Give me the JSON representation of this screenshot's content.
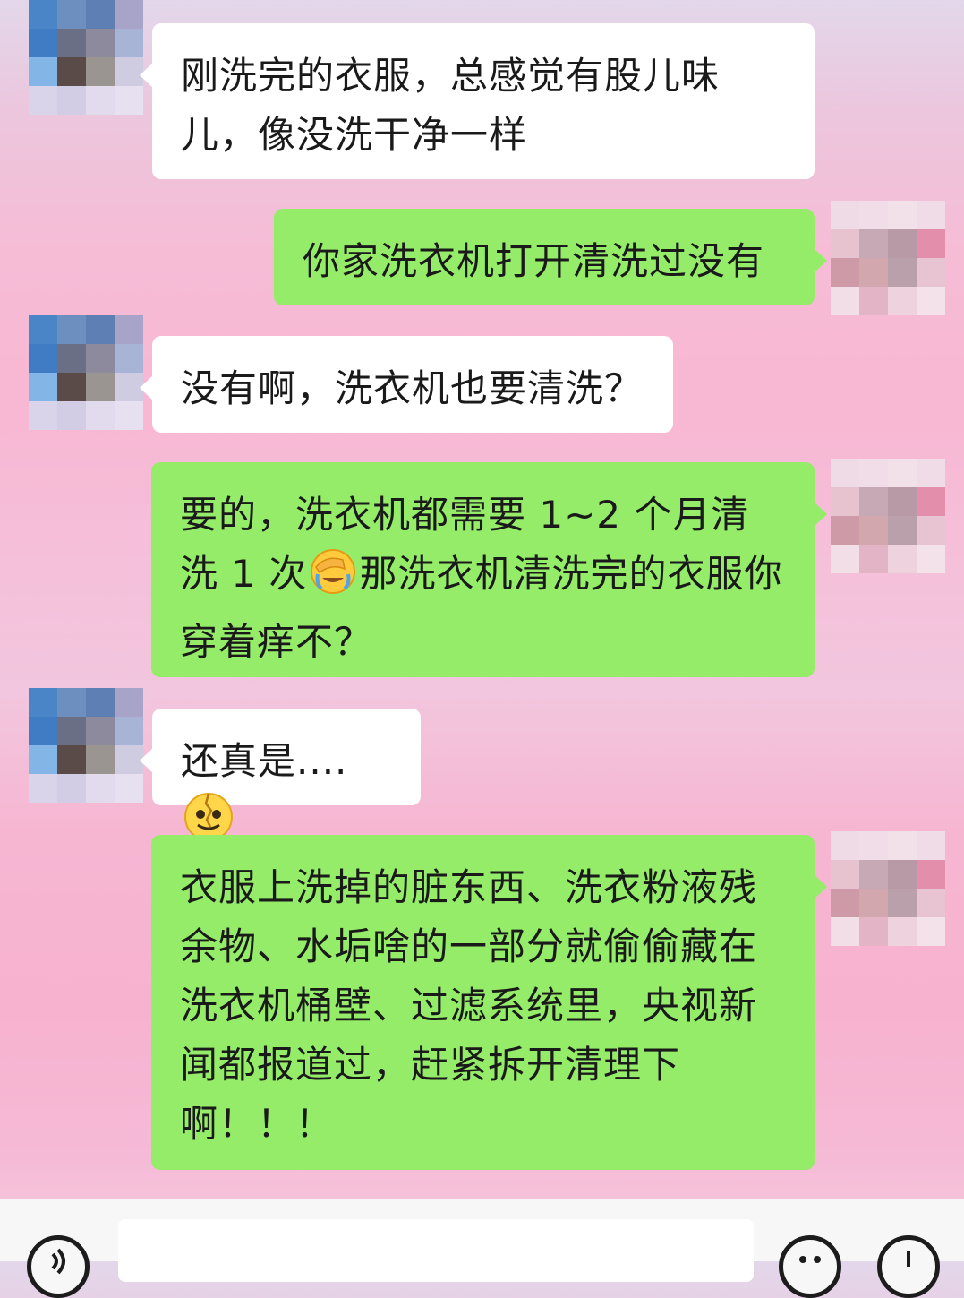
{
  "messages": [
    {
      "id": "m1",
      "side": "left",
      "text": "刚洗完的衣服，总感觉有股儿味儿，像没洗干净一样"
    },
    {
      "id": "m2",
      "side": "right",
      "text": "你家洗衣机打开清洗过没有"
    },
    {
      "id": "m3",
      "side": "left",
      "text": "没有啊，洗衣机也要清洗？"
    },
    {
      "id": "m4",
      "side": "right",
      "text_before_emoji": "要的，洗衣机都需要 1~2 个月清洗 1 次",
      "emoji": "facepalm-crying",
      "text_after_emoji": "那洗衣机清洗完的衣服你穿着痒不？"
    },
    {
      "id": "m5",
      "side": "left",
      "text_before_emoji": "还真是....",
      "emoji": "cracked-smile"
    },
    {
      "id": "m6",
      "side": "right",
      "text": "衣服上洗掉的脏东西、洗衣粉液残余物、水垢啥的一部分就偷偷藏在洗衣机桶壁、过滤系统里，央视新闻都报道过，赶紧拆开清理下啊！！！"
    }
  ],
  "avatars": {
    "left": {
      "description": "pixelated-avatar",
      "colors": [
        "#4a86c7",
        "#6d8fbf",
        "#5e7fb3",
        "#a7a3c9",
        "#3f7cc4",
        "#6b6f85",
        "#8c8a9c",
        "#a8b4d6",
        "#83b6e6",
        "#5a4a48",
        "#9a9590",
        "#cfcbe0",
        "#d9d4ea",
        "#d2cde4",
        "#e2dbee",
        "#e6e0f0"
      ]
    },
    "right": {
      "description": "pixelated-avatar",
      "colors": [
        "#eedbe5",
        "#f1dde7",
        "#f3e1ea",
        "#f0dce6",
        "#e7c2cf",
        "#c7a9b5",
        "#b79aa6",
        "#e38fab",
        "#cf9aa8",
        "#d2a7ae",
        "#b9a0ab",
        "#e8c4d2",
        "#f2dee7",
        "#e3b4c6",
        "#eed3df",
        "#f3e2ea"
      ]
    }
  },
  "input_bar": {
    "voice_icon": "voice-icon",
    "emoji_icon": "smiley-icon",
    "plus_icon": "plus-icon",
    "placeholder": ""
  }
}
